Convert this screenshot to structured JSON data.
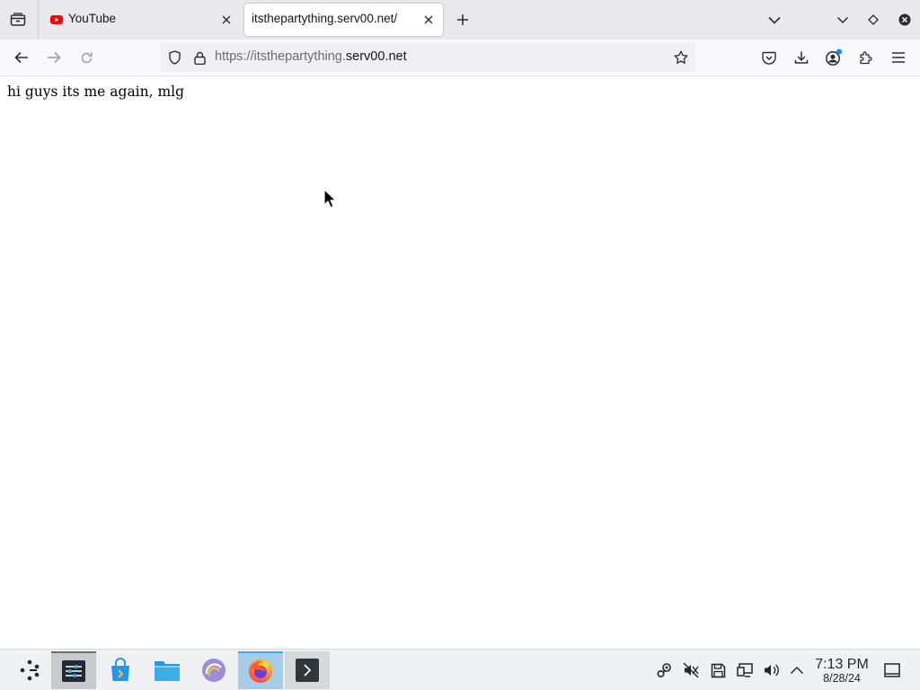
{
  "browser": {
    "tabs": [
      {
        "title": "YouTube",
        "favicon": "youtube-icon",
        "active": false
      },
      {
        "title": "itsthepartything.serv00.net/",
        "favicon": "",
        "active": true
      }
    ],
    "url": {
      "prefix": "https://itsthepartything.",
      "host": "serv00.net"
    }
  },
  "page": {
    "text": "hi guys its me again, mlg"
  },
  "taskbar": {
    "apps": [
      "launcher-icon",
      "system-settings-icon",
      "discover-store-icon",
      "file-manager-icon",
      "krunner-icon",
      "firefox-icon",
      "terminal-icon"
    ],
    "active_app": "firefox-icon",
    "tray": [
      "steam-icon",
      "mute-icon",
      "save-icon",
      "display-icon",
      "volume-icon",
      "expand-tray-icon"
    ],
    "clock": {
      "time": "7:13 PM",
      "date": "8/28/24"
    }
  },
  "colors": {
    "tabstrip_bg": "#e8e8ed",
    "taskbar_bg": "#eff0f1",
    "active_taskbar": "#a6cce8",
    "youtube_red": "#ff0000"
  }
}
